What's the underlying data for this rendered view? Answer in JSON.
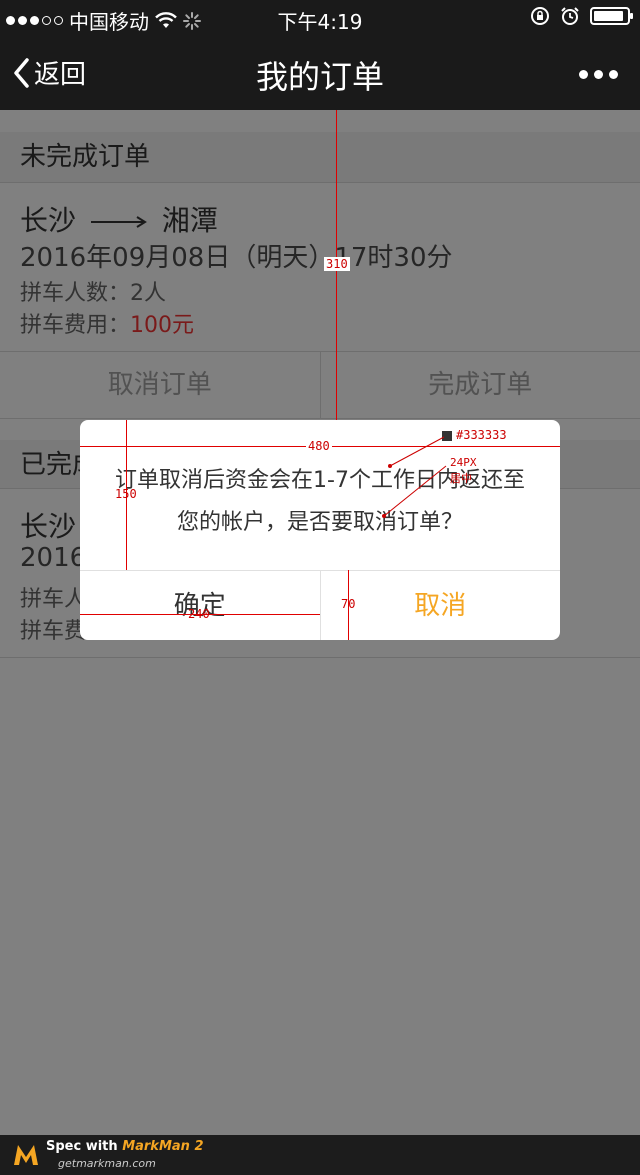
{
  "status_bar": {
    "carrier": "中国移动",
    "time": "下午4:19",
    "battery_level": 0.9
  },
  "nav": {
    "back_label": "返回",
    "title": "我的订单"
  },
  "sections": {
    "pending": {
      "header": "未完成订单",
      "route_from": "长沙",
      "route_to": "湘潭",
      "datetime": "2016年09月08日（明天）17时30分",
      "people_label": "拼车人数：",
      "people_value": "2人",
      "fee_label": "拼车费用：",
      "fee_value": "100元",
      "cancel_label": "取消订单",
      "complete_label": "完成订单"
    },
    "completed": {
      "header": "已完成",
      "route_from": "长沙",
      "datetime": "2016",
      "people_label": "拼车人",
      "fee_label": "拼车费"
    }
  },
  "dialog": {
    "message_line1": "订单取消后资金会在1-7个工作日内返还至",
    "message_line2": "您的帐户，是否要取消订单？",
    "ok_label": "确定",
    "cancel_label": "取消"
  },
  "annotations": {
    "width_480": "480",
    "height_150": "150",
    "width_240": "240",
    "height_70": "70",
    "top_310": "310",
    "color_code": "#333333",
    "font_size": "24PX",
    "centered": "居中"
  },
  "footer": {
    "spec_with": "Spec with ",
    "brand": "MarkMan 2",
    "url": "getmarkman.com"
  },
  "colors": {
    "accent": "#f5a623",
    "text": "#333333",
    "price": "#d0021b",
    "annotation": "#e00000"
  }
}
